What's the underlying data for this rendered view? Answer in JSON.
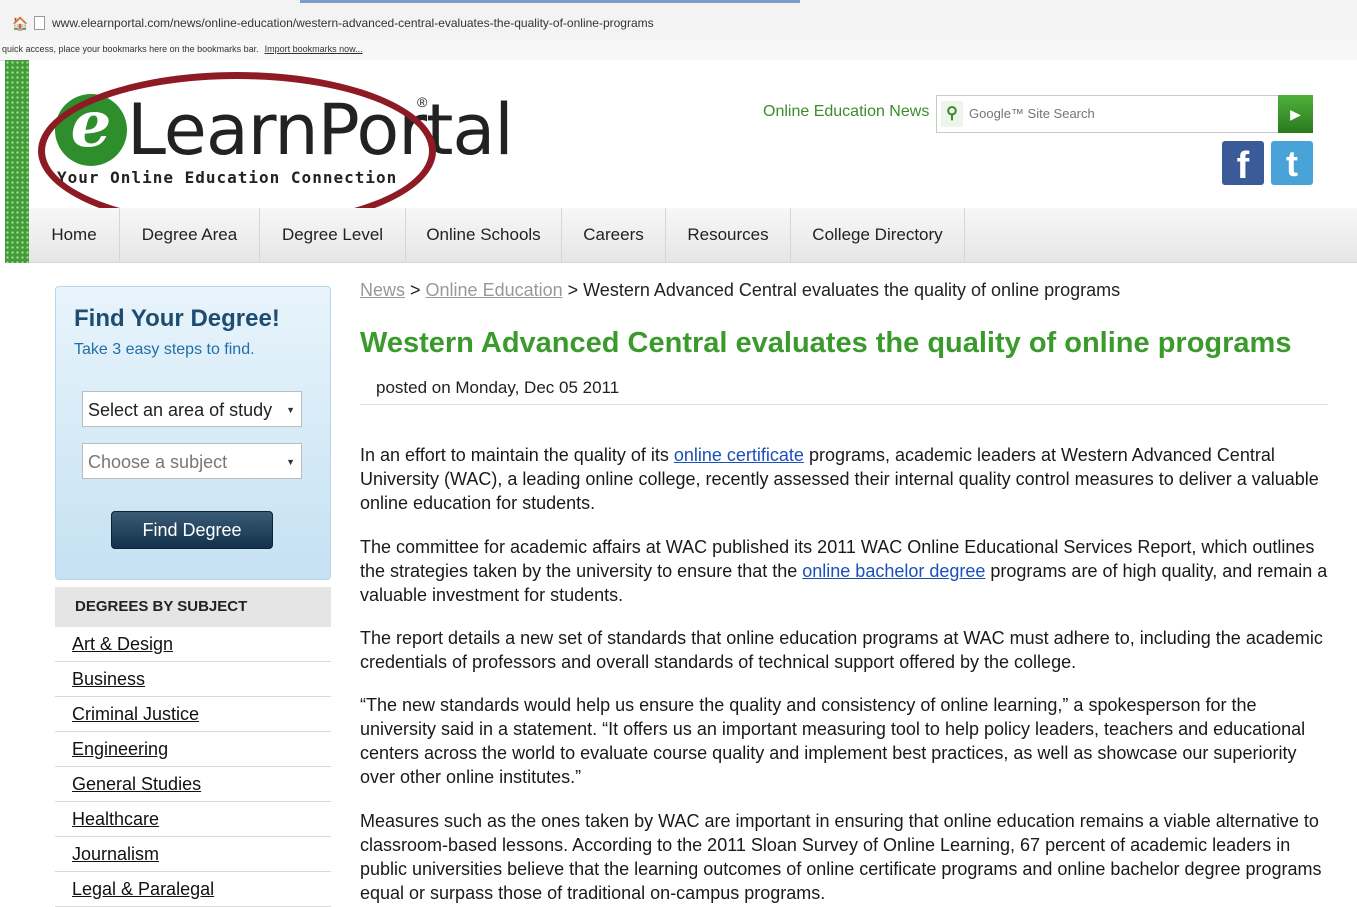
{
  "browser": {
    "url": "www.elearnportal.com/news/online-education/western-advanced-central-evaluates-the-quality-of-online-programs",
    "bookmarks_text": "quick access, place your bookmarks here on the bookmarks bar.",
    "import_bookmarks": "Import bookmarks now..."
  },
  "header": {
    "logo_e": "e",
    "logo_word": "LearnPortal",
    "logo_reg": "®",
    "logo_tagline": "Your Online Education Connection",
    "news_link": "Online Education News",
    "search_placeholder": "Google™ Site Search",
    "search_go": "▶",
    "facebook_glyph": "f",
    "twitter_glyph": "t"
  },
  "nav": {
    "items": [
      "Home",
      "Degree Area",
      "Degree Level",
      "Online Schools",
      "Careers",
      "Resources",
      "College Directory"
    ]
  },
  "find_degree": {
    "title": "Find Your Degree!",
    "subtitle": "Take 3 easy steps to find.",
    "area_select": "Select an area of study",
    "subject_select": "Choose a subject",
    "select_arrow": "▼",
    "button": "Find Degree"
  },
  "subjects": {
    "header": "DEGREES BY SUBJECT",
    "items": [
      "Art & Design",
      "Business",
      "Criminal Justice",
      "Engineering",
      "General Studies",
      "Healthcare",
      "Journalism",
      "Legal & Paralegal"
    ]
  },
  "article": {
    "breadcrumb": {
      "news": "News",
      "sep1": " > ",
      "online_education": "Online Education",
      "sep2": " > ",
      "current": "Western Advanced Central evaluates the quality of online programs"
    },
    "title": "Western Advanced Central evaluates the quality of online programs",
    "posted_on": "posted on Monday, Dec 05 2011",
    "p1_a": "In an effort to maintain the quality of its ",
    "p1_link": "online certificate",
    "p1_b": " programs, academic leaders at Western Advanced Central University (WAC), a leading online college, recently assessed their internal quality control measures to deliver a valuable online education for students.",
    "p2_a": "The committee for academic affairs at WAC published its 2011 WAC Online Educational Services Report, which outlines the strategies taken by the university to ensure that the ",
    "p2_link": "online bachelor degree",
    "p2_b": " programs are of high quality, and remain a valuable investment for students.",
    "p3": "The report details a new set of standards that online education programs at WAC must adhere to, including the academic credentials of professors and overall standards of technical support offered by the college.",
    "p4": "“The new standards would help us ensure the quality and consistency of online learning,” a spokesperson for the university said in a statement. “It offers us an important measuring tool to help policy leaders, teachers and educational centers across the world to evaluate course quality and implement best practices, as well as showcase our superiority over other online institutes.”",
    "p5": "Measures such as the ones taken by WAC are important in ensuring that online education remains a viable alternative to classroom-based lessons. According to the 2011 Sloan Survey of Online Learning, 67 percent of academic leaders in public universities believe that the learning outcomes of online certificate programs and online bachelor degree programs equal or surpass those of traditional on-campus programs."
  },
  "colors": {
    "brand_green": "#3a9a2c",
    "annotation_ellipse": "#8e1b23",
    "nav_text": "#222222",
    "link_blue": "#1a4fb8"
  }
}
